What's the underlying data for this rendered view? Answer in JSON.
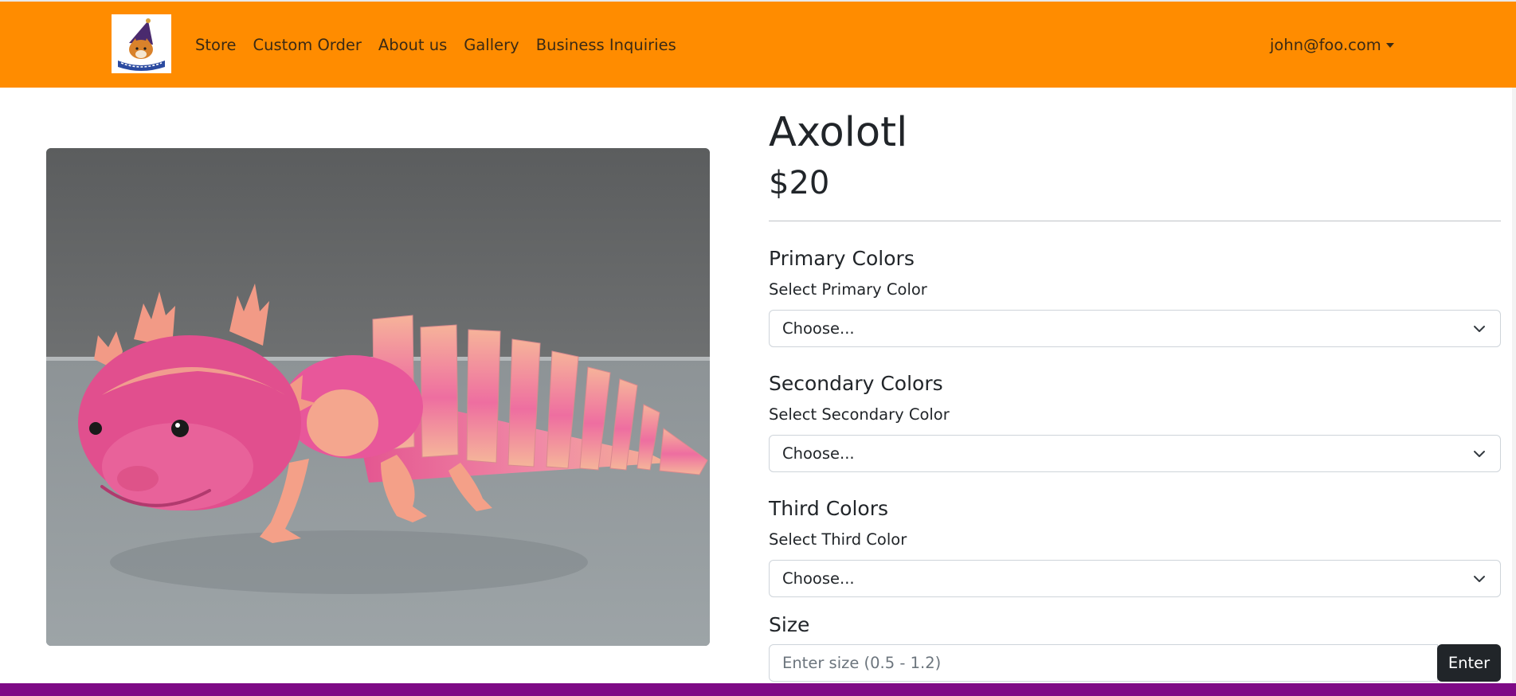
{
  "navbar": {
    "logo_text": "3D Wizards",
    "links": [
      {
        "label": "Store"
      },
      {
        "label": "Custom Order"
      },
      {
        "label": "About us"
      },
      {
        "label": "Gallery"
      },
      {
        "label": "Business Inquiries"
      }
    ],
    "user_email": "john@foo.com",
    "background_color": "#ff8c00"
  },
  "product": {
    "title": "Axolotl",
    "price": "$20",
    "image_subject": "pink and peach 3D printed articulated axolotl"
  },
  "options": {
    "primary": {
      "heading": "Primary Colors",
      "label": "Select Primary Color",
      "selected": "Choose..."
    },
    "secondary": {
      "heading": "Secondary Colors",
      "label": "Select Secondary Color",
      "selected": "Choose..."
    },
    "third": {
      "heading": "Third Colors",
      "label": "Select Third Color",
      "selected": "Choose..."
    },
    "size": {
      "heading": "Size",
      "placeholder": "Enter size (0.5 - 1.2)",
      "button_label": "Enter"
    }
  },
  "footer": {
    "bar_color": "#7e0a86"
  }
}
